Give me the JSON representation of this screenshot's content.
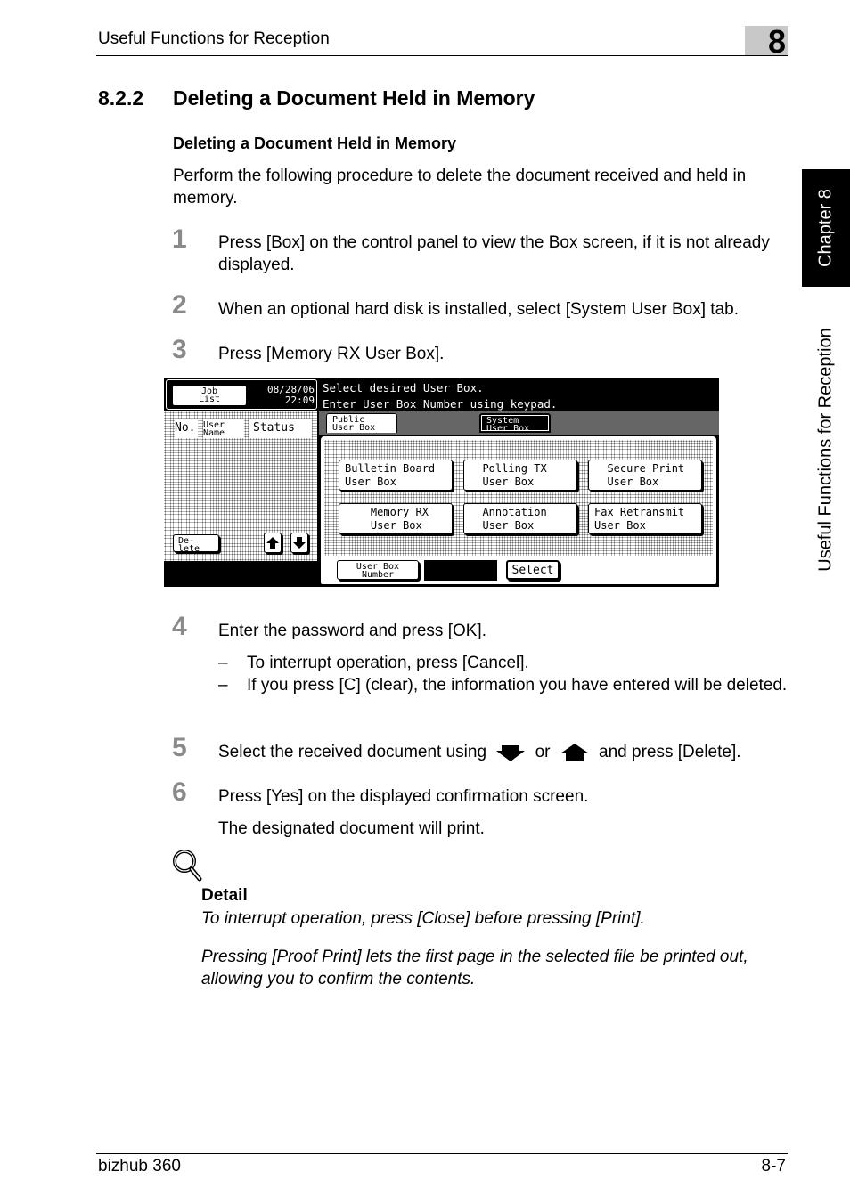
{
  "header": {
    "running_head": "Useful Functions for Reception",
    "chapter_number": "8"
  },
  "side_tab": {
    "chapter_label": "Chapter 8",
    "section_label": "Useful Functions for Reception"
  },
  "section": {
    "number": "8.2.2",
    "title": "Deleting a Document Held in Memory",
    "subheading": "Deleting a Document Held in Memory",
    "intro": "Perform the following procedure to delete the document received and held in memory."
  },
  "steps": [
    {
      "num": "1",
      "text": "Press [Box] on the control panel to view the Box screen, if it is not already displayed."
    },
    {
      "num": "2",
      "text": "When an optional hard disk is installed, select [System User Box] tab."
    },
    {
      "num": "3",
      "text": "Press [Memory RX User Box]."
    },
    {
      "num": "4",
      "text": "Enter the password and press [OK].",
      "bullets": [
        "To interrupt operation, press [Cancel].",
        "If you press [C] (clear), the information you have entered will be deleted."
      ]
    },
    {
      "num": "5",
      "text_before": "Select the received document using",
      "text_mid": "or",
      "text_after": "and press [Delete].",
      "icons": [
        "down-arrow-icon",
        "up-arrow-icon"
      ]
    },
    {
      "num": "6",
      "text": "Press [Yes] on the displayed confirmation screen.",
      "result": "The designated document will print."
    }
  ],
  "bullet_dash": "–",
  "screen": {
    "job_list": "Job\nList",
    "date": "08/28/06",
    "time": "22:09",
    "message_line1": "Select desired User Box.",
    "message_line2": "Enter User Box Number using keypad.",
    "columns": {
      "no": "No.",
      "user_name": "User\nName",
      "status": "Status"
    },
    "delete_button": "De-\nlete",
    "tabs": {
      "public": "Public\nUser Box",
      "system": "System\nUser Box"
    },
    "selected_tab": "system",
    "boxes": [
      "Bulletin Board\nUser Box",
      "  Polling TX\n  User Box",
      "  Secure Print\n  User Box",
      "    Memory RX\n    User Box",
      "  Annotation\n  User Box",
      "Fax Retransmit\nUser Box"
    ],
    "user_box_number_button": "User Box\nNumber",
    "select_button": "Select"
  },
  "detail": {
    "label": "Detail",
    "text1": "To interrupt operation, press [Close] before pressing [Print].",
    "text2": "Pressing [Proof Print] lets the first page in the selected file be printed out, allowing you to confirm the contents."
  },
  "footer": {
    "product": "bizhub 360",
    "page": "8-7"
  }
}
